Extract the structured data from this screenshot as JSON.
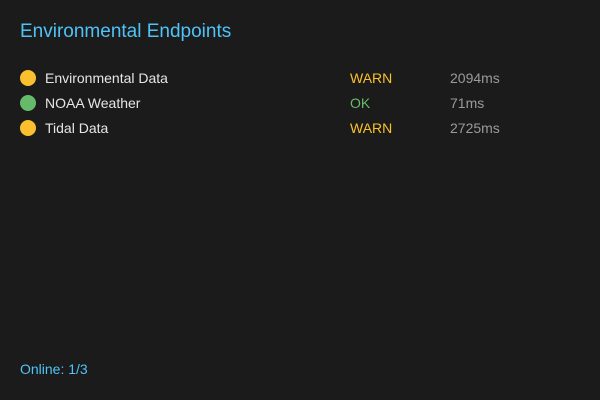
{
  "header": {
    "title": "Environmental Endpoints"
  },
  "colors": {
    "warn": "#fbc02d",
    "ok": "#66bb6a",
    "accent": "#4fc3f7"
  },
  "endpoints": [
    {
      "name": "Environmental Data",
      "status": "WARN",
      "latency": "2094ms",
      "icon": "status-dot-warn-icon"
    },
    {
      "name": "NOAA Weather",
      "status": "OK",
      "latency": "71ms",
      "icon": "status-dot-ok-icon"
    },
    {
      "name": "Tidal Data",
      "status": "WARN",
      "latency": "2725ms",
      "icon": "status-dot-warn-icon"
    }
  ],
  "footer": {
    "online_label": "Online: 1/3"
  }
}
